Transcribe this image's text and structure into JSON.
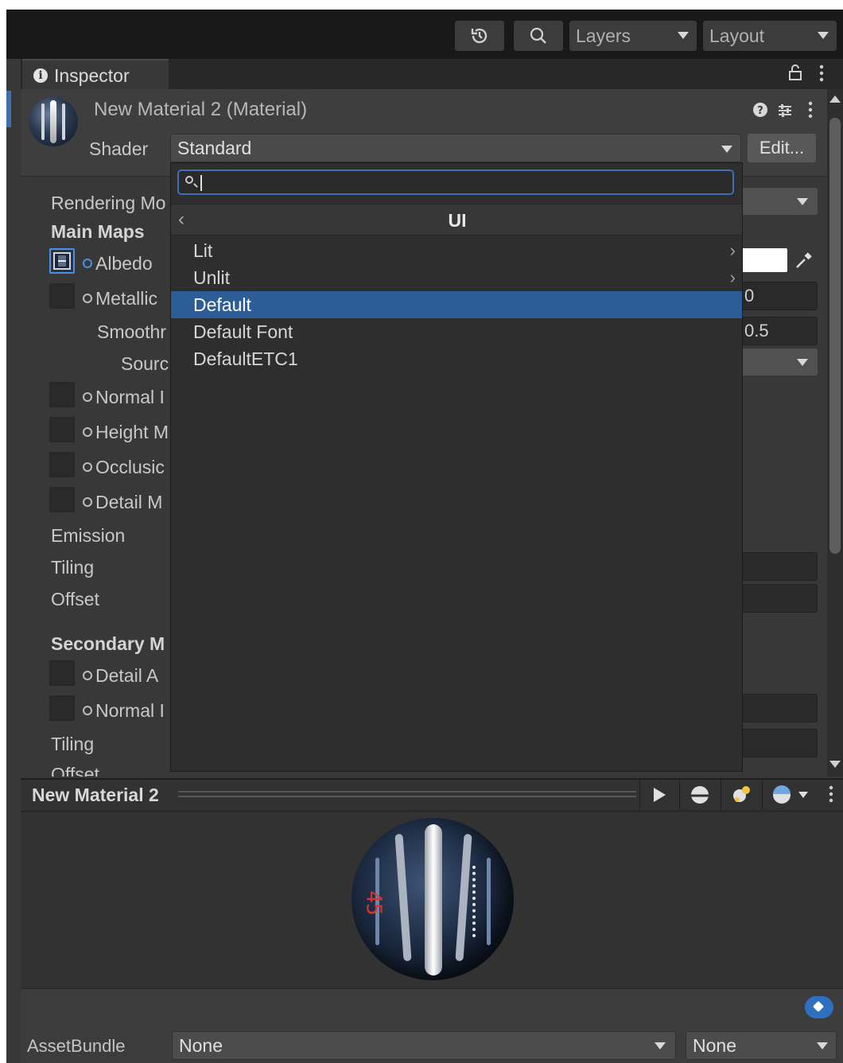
{
  "toolbar": {
    "layers_label": "Layers",
    "layout_label": "Layout",
    "history_icon": "history-icon",
    "search_icon": "search-icon"
  },
  "inspector": {
    "tab_label": "Inspector",
    "title": "New Material 2 (Material)",
    "shader_label": "Shader",
    "shader_value": "Standard",
    "edit_label": "Edit..."
  },
  "properties": {
    "rendering_mode": "Rendering Mo",
    "main_maps": "Main Maps",
    "albedo": "Albedo",
    "metallic": "Metallic",
    "smoothness": "Smoothr",
    "source": "Sourc",
    "normal_map": "Normal I",
    "height_map": "Height M",
    "occlusion": "Occlusic",
    "detail_mask": "Detail M",
    "emission": "Emission",
    "tiling": "Tiling",
    "offset": "Offset",
    "secondary_maps": "Secondary M",
    "detail_albedo": "Detail A",
    "normal_map_2": "Normal I",
    "tiling_2": "Tiling",
    "offset_2": "Offset",
    "metallic_value": "0",
    "smoothness_value": "0.5"
  },
  "popup": {
    "search_value": "",
    "header": "UI",
    "items": [
      {
        "label": "Lit",
        "has_submenu": true
      },
      {
        "label": "Unlit",
        "has_submenu": true
      },
      {
        "label": "Default",
        "selected": true
      },
      {
        "label": "Default Font"
      },
      {
        "label": "DefaultETC1"
      }
    ]
  },
  "preview": {
    "title": "New Material 2"
  },
  "bottom": {
    "assetbundle_label": "AssetBundle",
    "bundle_value": "None",
    "variant_value": "None"
  },
  "colors": {
    "accent": "#2c5d96",
    "search_border": "#3f6fb6",
    "tag": "#2f6fc0"
  }
}
